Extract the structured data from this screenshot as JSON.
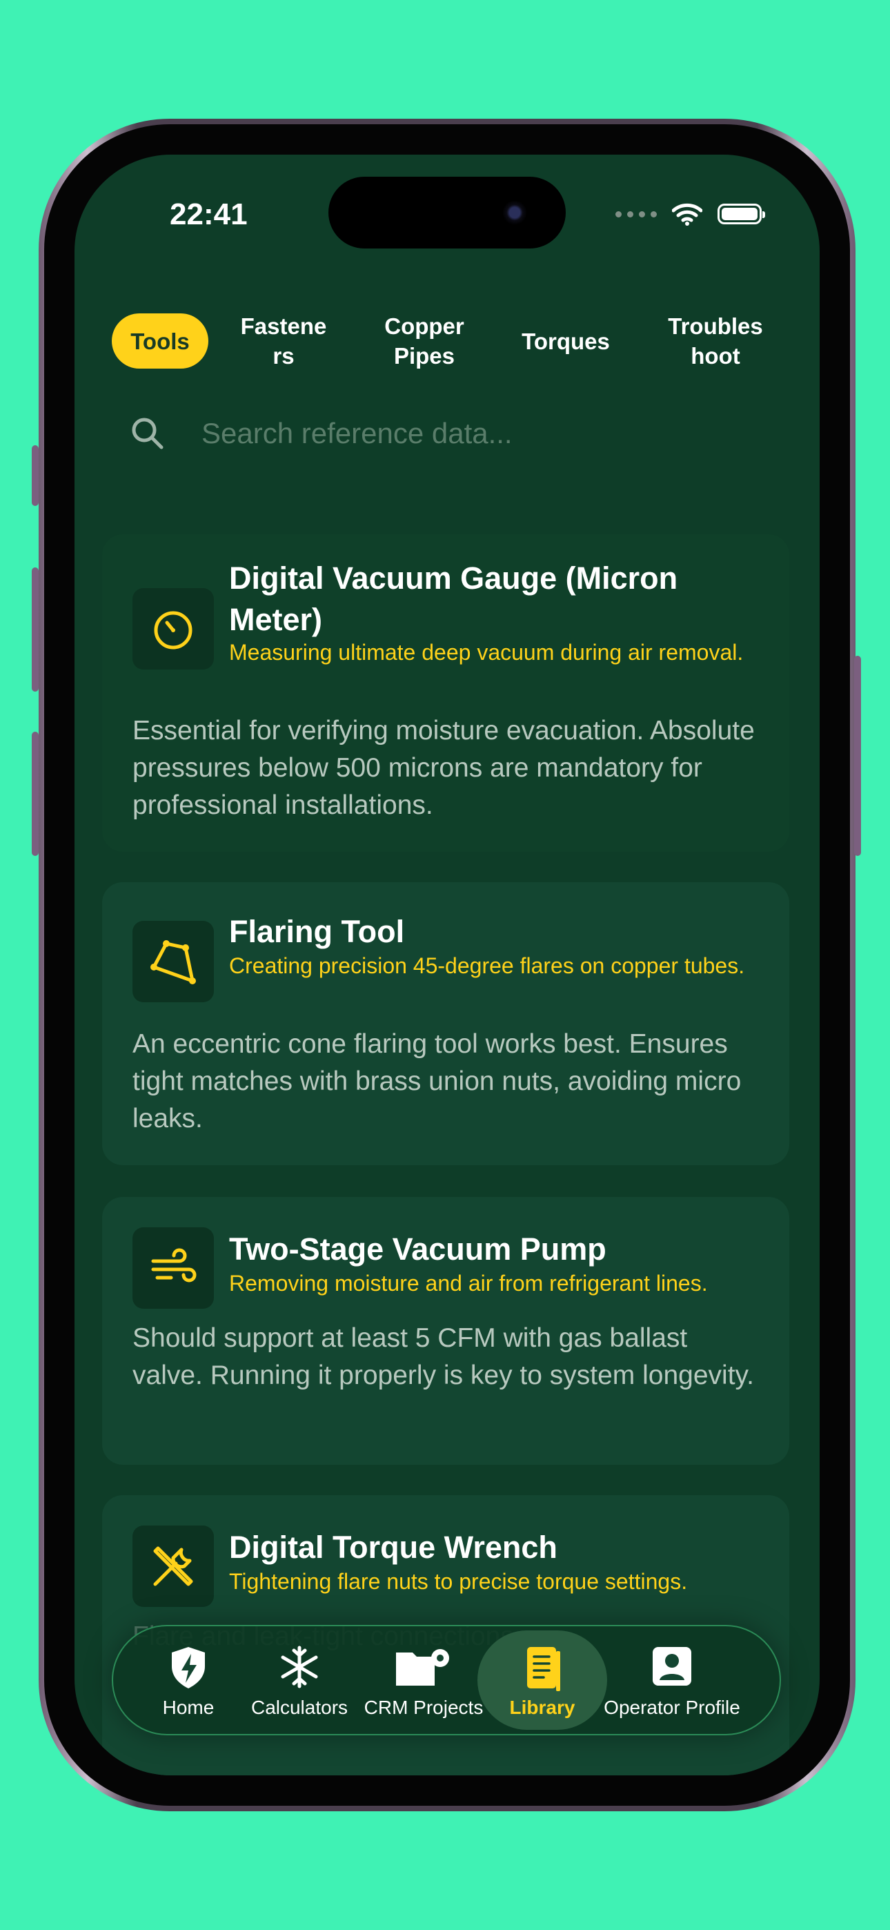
{
  "status": {
    "time": "22:41"
  },
  "tabs": [
    {
      "label": "Tools",
      "active": true
    },
    {
      "label": "Fastene\nrs",
      "active": false
    },
    {
      "label": "Copper\nPipes",
      "active": false
    },
    {
      "label": "Torques",
      "active": false
    },
    {
      "label": "Troubles\nhoot",
      "active": false
    }
  ],
  "search": {
    "placeholder": "Search reference data..."
  },
  "cards": [
    {
      "icon": "gauge-icon",
      "title": "Digital Vacuum Gauge (Micron Meter)",
      "subtitle": "Measuring ultimate deep vacuum during air removal.",
      "description": "Essential for verifying moisture evacuation. Absolute pressures below 500 microns are mandatory for professional installations."
    },
    {
      "icon": "flaring-tool-icon",
      "title": "Flaring Tool",
      "subtitle": "Creating precision 45-degree flares on copper tubes.",
      "description": "An eccentric cone flaring tool works best. Ensures tight matches with brass union nuts, avoiding micro leaks."
    },
    {
      "icon": "wind-icon",
      "title": "Two-Stage Vacuum Pump",
      "subtitle": "Removing moisture and air from refrigerant lines.",
      "description": "Should support at least 5 CFM with gas ballast valve. Running it properly is key to system longevity."
    },
    {
      "icon": "wrench-screwdriver-icon",
      "title": "Digital Torque Wrench",
      "subtitle": "Tightening flare nuts to precise torque settings.",
      "description": "Flare and leak-tight connections..."
    }
  ],
  "nav": [
    {
      "label": "Home",
      "icon": "shield-bolt-icon",
      "active": false
    },
    {
      "label": "Calculators",
      "icon": "snowflake-icon",
      "active": false
    },
    {
      "label": "CRM Projects",
      "icon": "folder-gear-icon",
      "active": false
    },
    {
      "label": "Library",
      "icon": "book-icon",
      "active": true
    },
    {
      "label": "Operator Profile",
      "icon": "person-icon",
      "active": false
    }
  ],
  "colors": {
    "background": "#3ff2b4",
    "screen": "#0e3d28",
    "accent": "#ffd21a",
    "card": "#134631"
  }
}
